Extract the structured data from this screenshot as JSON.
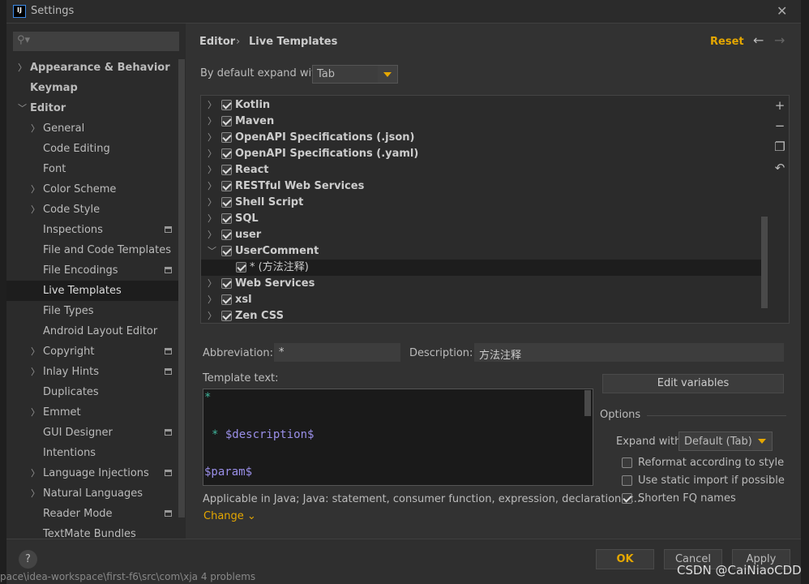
{
  "window": {
    "title": "Settings",
    "close_icon": "close-icon"
  },
  "sidebar": {
    "search_placeholder": "",
    "items": [
      {
        "label": "Appearance & Behavior",
        "level": 0,
        "chevron": "right",
        "bold": true
      },
      {
        "label": "Keymap",
        "level": 0,
        "bold": true
      },
      {
        "label": "Editor",
        "level": 0,
        "chevron": "down",
        "bold": true
      },
      {
        "label": "General",
        "level": 1,
        "chevron": "right"
      },
      {
        "label": "Code Editing",
        "level": 1
      },
      {
        "label": "Font",
        "level": 1
      },
      {
        "label": "Color Scheme",
        "level": 1,
        "chevron": "right"
      },
      {
        "label": "Code Style",
        "level": 1,
        "chevron": "right"
      },
      {
        "label": "Inspections",
        "level": 1,
        "project": true
      },
      {
        "label": "File and Code Templates",
        "level": 1
      },
      {
        "label": "File Encodings",
        "level": 1,
        "project": true
      },
      {
        "label": "Live Templates",
        "level": 1,
        "selected": true
      },
      {
        "label": "File Types",
        "level": 1
      },
      {
        "label": "Android Layout Editor",
        "level": 1
      },
      {
        "label": "Copyright",
        "level": 1,
        "chevron": "right",
        "project": true
      },
      {
        "label": "Inlay Hints",
        "level": 1,
        "chevron": "right",
        "project": true
      },
      {
        "label": "Duplicates",
        "level": 1
      },
      {
        "label": "Emmet",
        "level": 1,
        "chevron": "right"
      },
      {
        "label": "GUI Designer",
        "level": 1,
        "project": true
      },
      {
        "label": "Intentions",
        "level": 1
      },
      {
        "label": "Language Injections",
        "level": 1,
        "chevron": "right",
        "project": true
      },
      {
        "label": "Natural Languages",
        "level": 1,
        "chevron": "right"
      },
      {
        "label": "Reader Mode",
        "level": 1,
        "project": true
      },
      {
        "label": "TextMate Bundles",
        "level": 1
      }
    ]
  },
  "header": {
    "breadcrumb": [
      "Editor",
      "›",
      "Live Templates"
    ],
    "reset": "Reset"
  },
  "expand": {
    "label": "By default expand with",
    "value": "Tab"
  },
  "tree": [
    {
      "label": "Kotlin",
      "checked": true,
      "expanded": false
    },
    {
      "label": "Maven",
      "checked": true,
      "expanded": false
    },
    {
      "label": "OpenAPI Specifications (.json)",
      "checked": true,
      "expanded": false
    },
    {
      "label": "OpenAPI Specifications (.yaml)",
      "checked": true,
      "expanded": false
    },
    {
      "label": "React",
      "checked": true,
      "expanded": false
    },
    {
      "label": "RESTful Web Services",
      "checked": true,
      "expanded": false
    },
    {
      "label": "Shell Script",
      "checked": true,
      "expanded": false
    },
    {
      "label": "SQL",
      "checked": true,
      "expanded": false
    },
    {
      "label": "user",
      "checked": true,
      "expanded": false
    },
    {
      "label": "UserComment",
      "checked": true,
      "expanded": true
    },
    {
      "label": "* (方法注释)",
      "checked": true,
      "child": true,
      "selected": true
    },
    {
      "label": "Web Services",
      "checked": true,
      "expanded": false
    },
    {
      "label": "xsl",
      "checked": true,
      "expanded": false
    },
    {
      "label": "Zen CSS",
      "checked": true,
      "expanded": false
    }
  ],
  "toolbar": {
    "add": "+",
    "remove": "−",
    "copy_icon": "copy-icon",
    "revert_icon": "undo-icon"
  },
  "form": {
    "abbreviation_label": "Abbreviation:",
    "abbreviation": "*",
    "description_label": "Description:",
    "description": "方法注释",
    "template_label": "Template text:",
    "template_lines": [
      "*",
      "* $description$",
      "$param$"
    ],
    "applicable": "Applicable in Java; Java: statement, consumer function, expression, declaration, c...",
    "change": "Change ⌄",
    "edit_variables": "Edit variables"
  },
  "options": {
    "title": "Options",
    "expand_label": "Expand with",
    "expand_value": "Default (Tab)",
    "items": [
      {
        "label": "Reformat according to style",
        "checked": false
      },
      {
        "label": "Use static import if possible",
        "checked": false
      },
      {
        "label": "Shorten FQ names",
        "checked": true
      }
    ]
  },
  "footer": {
    "help": "?",
    "ok": "OK",
    "cancel": "Cancel",
    "apply": "Apply"
  },
  "watermark": "CSDN @CaiNiaoCDD",
  "background_status": "pace\\idea-workspace\\first-f6\\src\\com\\xja   4 problems",
  "colors": {
    "accent": "#e5a700",
    "template_green": "#3fb69d",
    "template_var": "#9a8fe8"
  }
}
